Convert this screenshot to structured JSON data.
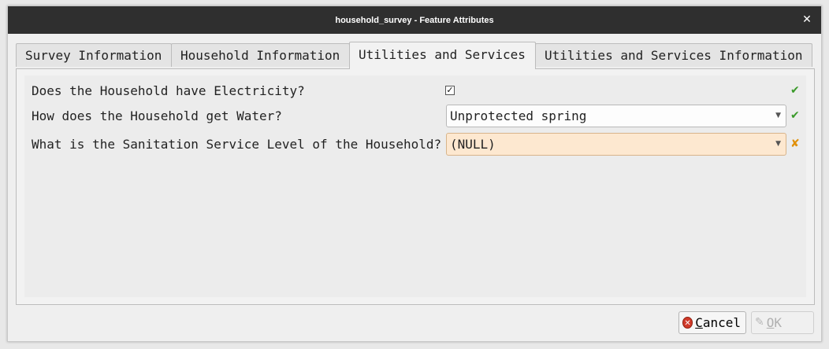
{
  "window": {
    "title": "household_survey - Feature Attributes",
    "close_icon": "close-icon"
  },
  "tabs": [
    {
      "label": "Survey Information",
      "active": false
    },
    {
      "label": "Household Information",
      "active": false
    },
    {
      "label": "Utilities and Services",
      "active": true
    },
    {
      "label": "Utilities and Services Information",
      "active": false
    }
  ],
  "form": {
    "electricity": {
      "label": "Does the Household have Electricity?",
      "checked": true,
      "check_glyph": "✓",
      "status_glyph": "✔",
      "status": "valid"
    },
    "water": {
      "label": "How does the Household get Water?",
      "value": "Unprotected spring",
      "status_glyph": "✔",
      "status": "valid"
    },
    "sanitation": {
      "label": "What is the Sanitation Service Level of the Household?",
      "value": "(NULL)",
      "status_glyph": "✘",
      "status": "invalid"
    },
    "dropdown_arrow": "▼"
  },
  "buttons": {
    "cancel_first": "C",
    "cancel_rest": "ancel",
    "cancel_icon_glyph": "✕",
    "ok_first": "O",
    "ok_rest": "K",
    "ok_icon_glyph": "✎",
    "ok_enabled": false
  },
  "colors": {
    "titlebar": "#2f2f2f",
    "valid": "#3a9a2a",
    "invalid": "#e0900a",
    "null_field": "#fde8d0",
    "cancel_icon": "#d03a2a"
  }
}
